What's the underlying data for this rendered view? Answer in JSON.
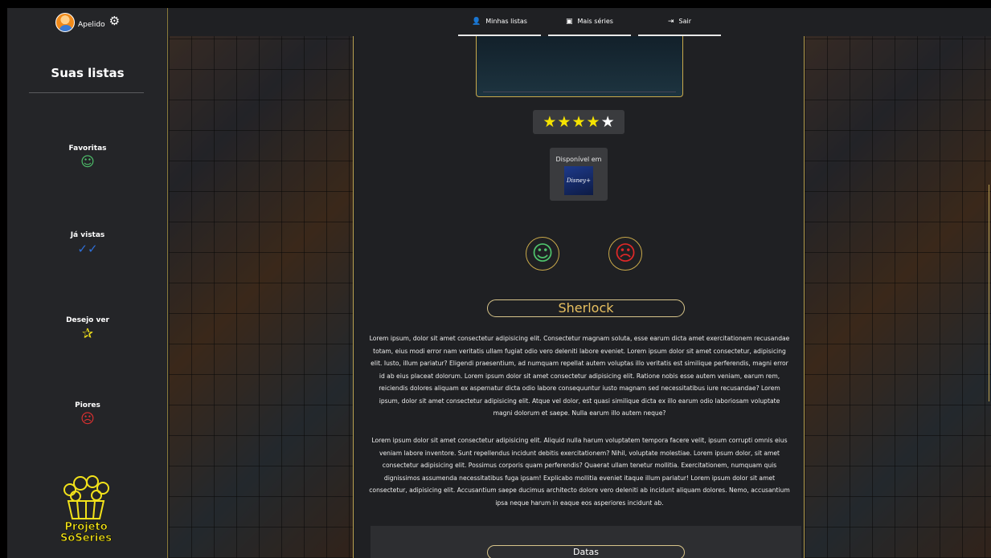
{
  "user": {
    "name": "Apelido"
  },
  "sidebar": {
    "title": "Suas listas",
    "items": [
      {
        "label": "Favoritas",
        "icon": "smile-icon"
      },
      {
        "label": "Já vistas",
        "icon": "double-check-icon"
      },
      {
        "label": "Desejo ver",
        "icon": "star-icon"
      },
      {
        "label": "Piores",
        "icon": "sad-icon"
      }
    ],
    "logo_text_line1": "Projeto",
    "logo_text_line2": "SóSeries"
  },
  "nav": [
    {
      "label": "Minhas listas",
      "icon": "user-icon"
    },
    {
      "label": "Mais séries",
      "icon": "tv-icon"
    },
    {
      "label": "Sair",
      "icon": "logout-icon"
    }
  ],
  "series": {
    "rating": 4,
    "rating_max": 5,
    "available_label": "Disponível em",
    "platform": "Disney+",
    "title": "Sherlock",
    "description_1": "Lorem ipsum, dolor sit amet consectetur adipisicing elit. Consectetur magnam soluta, esse earum dicta amet exercitationem recusandae totam, eius modi error nam veritatis ullam fugiat odio vero deleniti labore eveniet. Lorem ipsum dolor sit amet consectetur, adipisicing elit. Iusto, illum pariatur? Eligendi praesentium, ad numquam repellat autem voluptas illo veritatis est similique perferendis, magni error id ab eius placeat dolorum. Lorem ipsum dolor sit amet consectetur adipisicing elit. Ratione nobis esse autem veniam, earum rem, reiciendis dolores aliquam ex aspernatur dicta odio labore consequuntur iusto magnam sed necessitatibus iure recusandae? Lorem ipsum, dolor sit amet consectetur adipisicing elit. Atque vel dolor, est quasi similique dicta ex illo earum odio laboriosam voluptate magni dolorum et saepe. Nulla earum illo autem neque?",
    "description_2": "Lorem ipsum dolor sit amet consectetur adipisicing elit. Aliquid nulla harum voluptatem tempora facere velit, ipsum corrupti omnis eius veniam labore inventore. Sunt repellendus incidunt debitis exercitationem? Nihil, voluptate molestiae. Lorem ipsum dolor, sit amet consectetur adipisicing elit. Possimus corporis quam perferendis? Quaerat ullam tenetur mollitia. Exercitationem, numquam quis dignissimos assumenda necessitatibus fuga ipsam! Explicabo mollitia eveniet itaque illum pariatur! Lorem ipsum dolor sit amet consectetur, adipisicing elit. Accusantium saepe ducimus architecto dolore vero deleniti ab incidunt aliquam dolores. Nemo, accusantium ipsa neque harum in eaque eos asperiores incidunt ab.",
    "dates_label": "Datas"
  },
  "colors": {
    "accent_gold": "#c9a94a",
    "title_gold": "#e8c060",
    "star_yellow": "#f5e300",
    "like_green": "#4fc36c",
    "dislike_red": "#e02828"
  }
}
